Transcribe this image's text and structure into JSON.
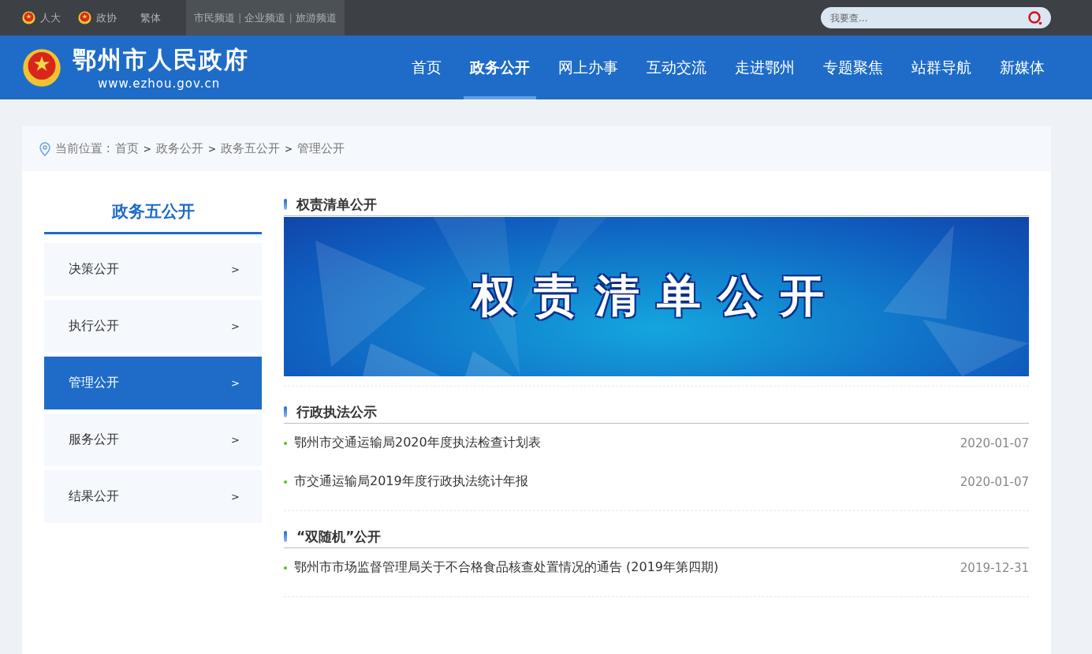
{
  "topbar": {
    "links": [
      "人大",
      "政协"
    ],
    "lang": "繁体",
    "channels": [
      {
        "label": "市民频道",
        "kind": "link"
      },
      {
        "label": "|",
        "kind": "sep"
      },
      {
        "label": "企业频道",
        "kind": "link"
      },
      {
        "label": "|",
        "kind": "sep"
      },
      {
        "label": "旅游频道",
        "kind": "link"
      }
    ],
    "search": {
      "placeholder": "我要查..."
    }
  },
  "header": {
    "site_name": "鄂州市人民政府",
    "url": "www.ezhou.gov.cn",
    "nav": [
      {
        "label": "首页",
        "selected": false
      },
      {
        "label": "政务公开",
        "selected": true
      },
      {
        "label": "网上办事",
        "selected": false
      },
      {
        "label": "互动交流",
        "selected": false
      },
      {
        "label": "走进鄂州",
        "selected": false
      },
      {
        "label": "专题聚焦",
        "selected": false
      },
      {
        "label": "站群导航",
        "selected": false
      },
      {
        "label": "新媒体",
        "selected": false
      }
    ]
  },
  "breadcrumb": {
    "label": "当前位置 :",
    "parts": [
      {
        "label": "首页",
        "kind": "link"
      },
      {
        "label": ">",
        "kind": "sep"
      },
      {
        "label": "政务公开",
        "kind": "link"
      },
      {
        "label": ">",
        "kind": "sep"
      },
      {
        "label": "政务五公开",
        "kind": "link"
      },
      {
        "label": ">",
        "kind": "sep"
      },
      {
        "label": "管理公开",
        "kind": "link"
      }
    ]
  },
  "sidebar": {
    "title": "政务五公开",
    "items": [
      {
        "label": "决策公开",
        "arrow": ">",
        "selected": false
      },
      {
        "label": "执行公开",
        "arrow": ">",
        "selected": false
      },
      {
        "label": "管理公开",
        "arrow": ">",
        "selected": true
      },
      {
        "label": "服务公开",
        "arrow": ">",
        "selected": false
      },
      {
        "label": "结果公开",
        "arrow": ">",
        "selected": false
      }
    ]
  },
  "sections": [
    {
      "title": "权责清单公开",
      "kind": "banner",
      "banner_text": "权责清单公开"
    },
    {
      "title": "行政执法公示",
      "kind": "list",
      "items": [
        {
          "title": "鄂州市交通运输局2020年度执法检查计划表",
          "date": "2020-01-07"
        },
        {
          "title": "市交通运输局2019年度行政执法统计年报",
          "date": "2020-01-07"
        }
      ]
    },
    {
      "title": "“双随机”公开",
      "kind": "list",
      "items": [
        {
          "title": "鄂州市市场监督管理局关于不合格食品核查处置情况的通告 (2019年第四期)",
          "date": "2019-12-31"
        }
      ]
    }
  ]
}
